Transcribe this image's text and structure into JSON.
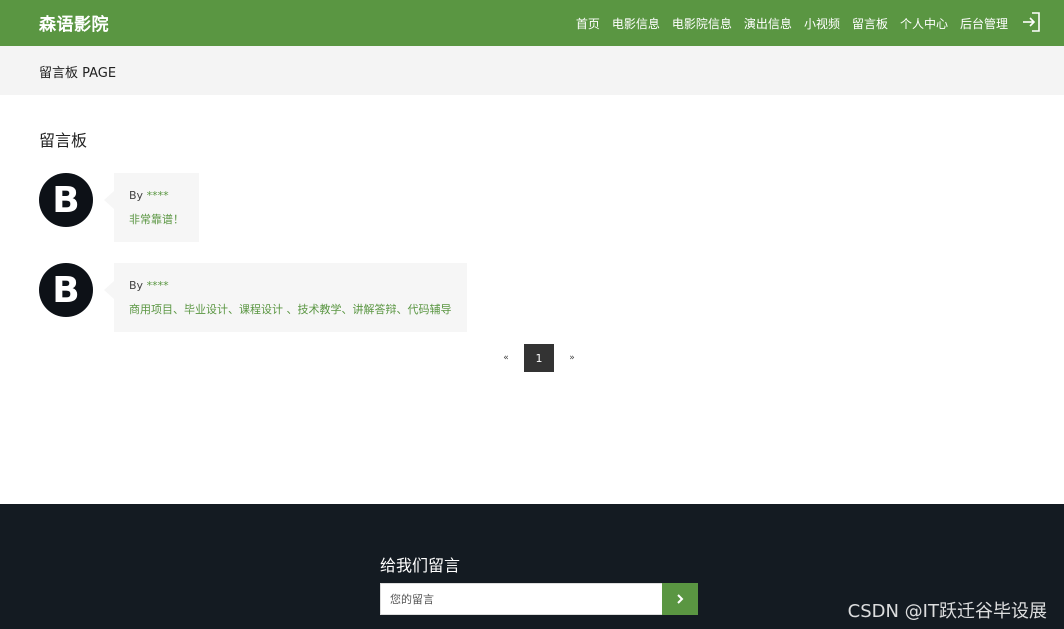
{
  "header": {
    "brand": "森语影院",
    "nav": [
      "首页",
      "电影信息",
      "电影院信息",
      "演出信息",
      "小视频",
      "留言板",
      "个人中心",
      "后台管理"
    ]
  },
  "breadcrumb": {
    "text": "留言板 PAGE"
  },
  "main": {
    "title": "留言板",
    "comments": [
      {
        "avatar_letter": "B",
        "by_label": "By",
        "author": "****",
        "message": "非常靠谱！"
      },
      {
        "avatar_letter": "B",
        "by_label": "By",
        "author": "****",
        "message": "商用项目、毕业设计、课程设计 、技术教学、讲解答辩、代码辅导"
      }
    ]
  },
  "pagination": {
    "prev": "«",
    "current": "1",
    "next": "»"
  },
  "footer": {
    "title": "给我们留言",
    "input_placeholder": "您的留言",
    "watermark": "CSDN @IT跃迁谷毕设展"
  },
  "colors": {
    "accent": "#5a9642",
    "footer_bg": "#141b22",
    "crumb_bg": "#f4f4f4",
    "avatar_bg": "#0d1117"
  },
  "icons": {
    "logout": "logout-icon",
    "submit": "chevron-right-icon"
  }
}
